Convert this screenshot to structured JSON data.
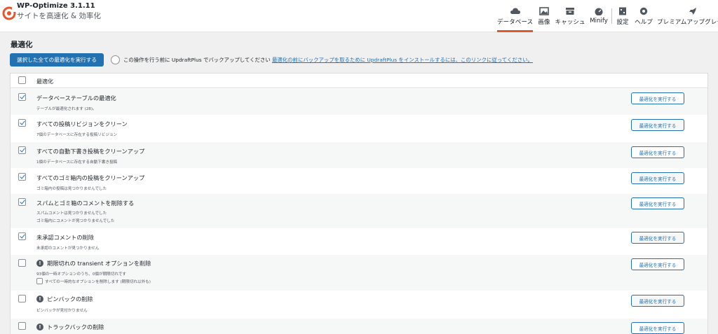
{
  "brand": {
    "name": "WP-Optimize 3.1.11",
    "subtitle": "サイトを高速化 & 効率化"
  },
  "colors": {
    "accent": "#e2572b",
    "primary": "#2271b1"
  },
  "nav": [
    {
      "label": "データベース",
      "icon": "database-icon",
      "active": true
    },
    {
      "label": "画像",
      "icon": "image-icon",
      "active": false
    },
    {
      "label": "キャッシュ",
      "icon": "cache-icon",
      "active": false
    },
    {
      "label": "Minify",
      "icon": "gauge-icon",
      "active": false
    },
    {
      "label": "設定",
      "icon": "settings-icon",
      "active": false
    },
    {
      "label": "ヘルプ",
      "icon": "lifebuoy-icon",
      "active": false
    },
    {
      "label": "プレミアムアップグレード",
      "icon": "rocket-icon",
      "active": false
    }
  ],
  "page": {
    "title": "最適化",
    "run_all_label": "選択した全ての最適化を実行する",
    "backup_text": "この操作を行う前に UpdraftPlus でバックアップしてください",
    "backup_link": "最適化の前にバックアップを取るために UpdraftPlus をインストールするには、このリンクに従ってください。"
  },
  "table": {
    "header_label": "最適化",
    "run_label": "最適化を実行する",
    "rows": [
      {
        "title": "データベーステーブルの最適化",
        "desc": [
          "テーブルが最適化されます (28)。"
        ],
        "checked": true,
        "info": false
      },
      {
        "title": "すべての投稿リビジョンをクリーン",
        "desc": [
          "7個のデータベースに存在する投稿リビジョン"
        ],
        "checked": true,
        "info": false
      },
      {
        "title": "すべての自動下書き投稿をクリーンアップ",
        "desc": [
          "1個のデータベースに存在する自動下書き投稿"
        ],
        "checked": true,
        "info": false
      },
      {
        "title": "すべてのゴミ箱内の投稿をクリーンアップ",
        "desc": [
          "ゴミ箱内の投稿は見つかりませんでした"
        ],
        "checked": true,
        "info": false
      },
      {
        "title": "スパムとゴミ箱のコメントを削除する",
        "desc": [
          "スパムコメントは見つかりませんでした",
          "ゴミ箱内にコメントが見つかりませんでした"
        ],
        "checked": true,
        "info": false
      },
      {
        "title": "未承認コメントの削除",
        "desc": [
          "未承認のコメントが見つかりません"
        ],
        "checked": true,
        "info": false
      },
      {
        "title": "期限切れの transient オプションを削除",
        "desc": [
          "93個の一時オプションのうち、0個が期限切れです"
        ],
        "sub_option": "すべての一時的なオプションを削除します (期限切れ以外も)",
        "checked": false,
        "info": true
      },
      {
        "title": "ピンバックの削除",
        "desc": [
          "ピンバックが見付かりません"
        ],
        "checked": false,
        "info": true
      },
      {
        "title": "トラックバックの削除",
        "desc": [],
        "checked": false,
        "info": true
      }
    ]
  }
}
